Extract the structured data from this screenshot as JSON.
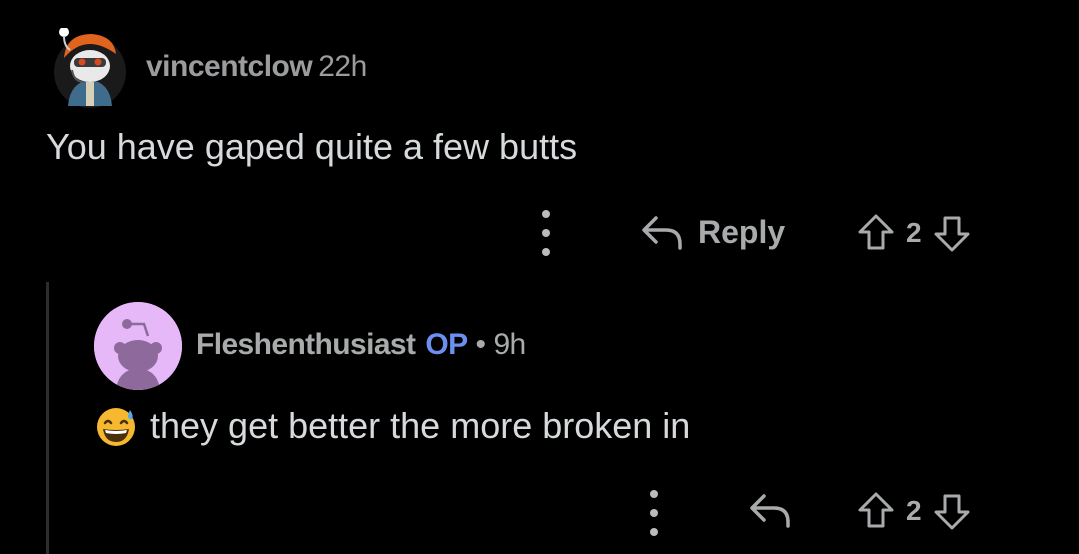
{
  "comments": [
    {
      "username": "vincentclow",
      "timestamp": "22h",
      "body": "You have gaped quite a few butts",
      "actions": {
        "more_icon": "more-vertical-icon",
        "reply_label": "Reply",
        "score": "2"
      }
    },
    {
      "username": "Fleshenthusiast",
      "op_badge": "OP",
      "separator": "•",
      "timestamp": "9h",
      "body": "they get better the more broken in",
      "emoji": "grinning-face-with-sweat-emoji",
      "actions": {
        "more_icon": "more-vertical-icon",
        "score": "2"
      }
    }
  ],
  "colors": {
    "background": "#000000",
    "text": "#d7dadc",
    "meta": "#a8aaab",
    "op": "#6c8ff0",
    "avatar_bg": "#e6b8f8"
  }
}
